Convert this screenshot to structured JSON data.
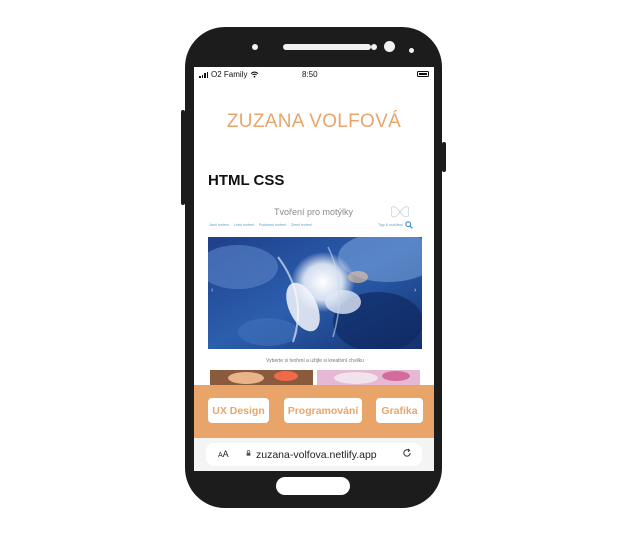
{
  "status_bar": {
    "carrier": "O2 Family",
    "time": "8:50",
    "icons": [
      "signal-icon",
      "wifi-icon",
      "battery-icon"
    ]
  },
  "site": {
    "title": "ZUZANA VOLFOVÁ",
    "section_title": "HTML CSS"
  },
  "preview": {
    "title": "Tvoření pro motýlky",
    "nav": [
      "Jarní tvoření",
      "Letní tvoření",
      "Podzimní tvoření",
      "Zimní tvoření"
    ],
    "search_label": "Tipy & rozšíření",
    "subtitle": "Vyberte si tvoření a užijte si kreativní chvilku"
  },
  "categories": {
    "ux": "UX Design",
    "programming": "Programování",
    "graphics": "Grafika"
  },
  "browser": {
    "text_size": "AA",
    "url": "zuzana-volfova.netlify.app"
  },
  "colors": {
    "accent": "#e8a56a",
    "accent_bar": "#e9a46a",
    "phone_body": "#1c1c1c"
  }
}
